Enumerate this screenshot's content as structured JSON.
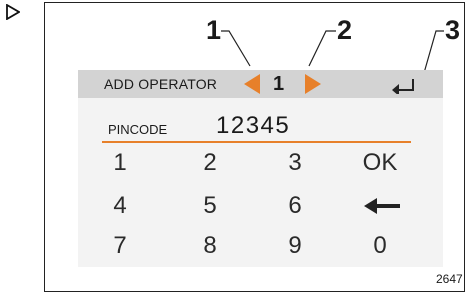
{
  "colors": {
    "accent": "#e7802a",
    "titlebar_bg": "#d3d3d3",
    "screen_bg": "#f3f3f3"
  },
  "callouts": [
    "1",
    "2",
    "3"
  ],
  "screen": {
    "title": "ADD OPERATOR",
    "page_number": "1",
    "pin_label": "PINCODE",
    "pin_value": "12345"
  },
  "keypad": {
    "keys": [
      "1",
      "2",
      "3",
      "OK",
      "4",
      "5",
      "6",
      "7",
      "8",
      "9",
      "0"
    ],
    "backspace_icon": "backspace-arrow-icon"
  },
  "figure_ref": "2647",
  "icons": {
    "left": "left-arrow-icon",
    "right": "right-arrow-icon",
    "back": "return-icon",
    "marker": "play-outline-icon"
  }
}
